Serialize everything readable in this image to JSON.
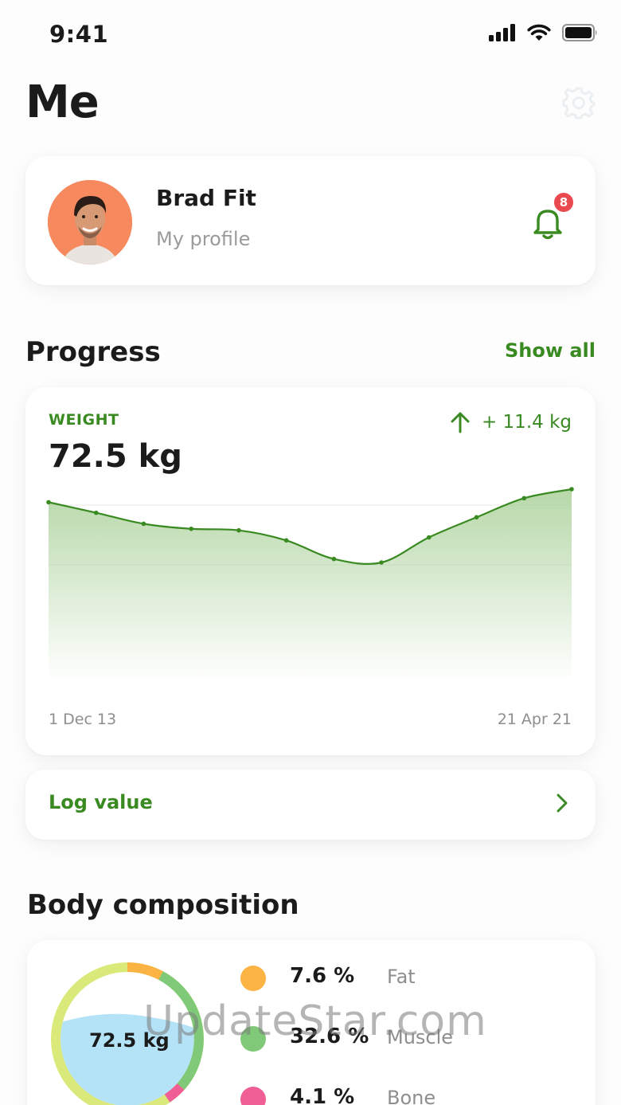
{
  "status_bar": {
    "time": "9:41"
  },
  "header": {
    "title": "Me"
  },
  "profile": {
    "name": "Brad Fit",
    "subtitle": "My profile",
    "notification_count": "8"
  },
  "progress": {
    "section_title": "Progress",
    "show_all_label": "Show all",
    "metric_label": "WEIGHT",
    "current_value": "72.5 kg",
    "change": "+ 11.4 kg",
    "start_date": "1 Dec 13",
    "end_date": "21 Apr 21",
    "chart_data": {
      "type": "area",
      "series": [
        {
          "values": [
            63.8,
            61.7,
            59.5,
            58.5,
            58.2,
            56.2,
            52.5,
            51.8,
            56.8,
            60.8,
            64.6,
            66.4
          ]
        }
      ]
    }
  },
  "log": {
    "label": "Log value"
  },
  "body_composition": {
    "section_title": "Body composition",
    "center_value": "72.5 kg",
    "items": [
      {
        "value": "7.6 %",
        "label": "Fat",
        "color": "#fbb444"
      },
      {
        "value": "32.6 %",
        "label": "Muscle",
        "color": "#7fc978"
      },
      {
        "value": "4.1 %",
        "label": "Bone",
        "color": "#ef5f95"
      }
    ],
    "ring_colors": {
      "base": "#d9ea7a",
      "water": "#b4e2f6"
    }
  },
  "watermark": "UpdateStar.com",
  "colors": {
    "accent": "#3a8a22",
    "badge": "#ea4a4f",
    "avatar_bg": "#f6895e"
  }
}
